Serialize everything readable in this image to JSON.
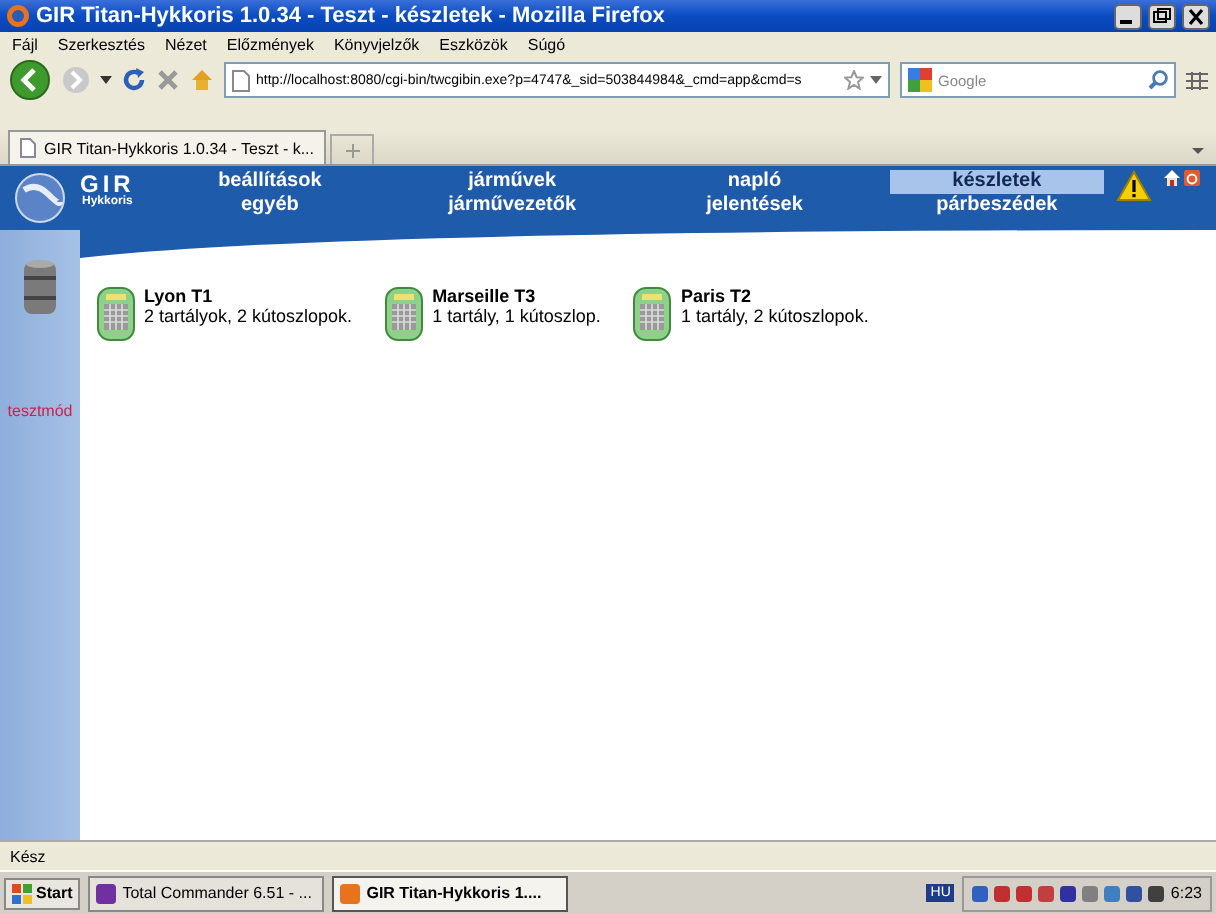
{
  "window": {
    "title": "GIR Titan-Hykkoris 1.0.34 - Teszt - készletek - Mozilla Firefox"
  },
  "menu": [
    "Fájl",
    "Szerkesztés",
    "Nézet",
    "Előzmények",
    "Könyvjelzők",
    "Eszközök",
    "Súgó"
  ],
  "address_bar": {
    "value": "http://localhost:8080/cgi-bin/twcgibin.exe?p=4747&_sid=503844984&_cmd=app&cmd=s"
  },
  "search": {
    "placeholder": "Google"
  },
  "browser_tabs": [
    {
      "label": "GIR Titan-Hykkoris 1.0.34 - Teszt - k...",
      "selected": true
    }
  ],
  "app": {
    "logo": {
      "title": "GIR",
      "subtitle": "Hykkoris"
    },
    "nav": [
      {
        "label": "beállítások",
        "selected": false
      },
      {
        "label": "járművek",
        "selected": false
      },
      {
        "label": "napló",
        "selected": false
      },
      {
        "label": "készletek",
        "selected": true
      },
      {
        "label": "egyéb",
        "selected": false
      },
      {
        "label": "járművezetők",
        "selected": false
      },
      {
        "label": "jelentések",
        "selected": false
      },
      {
        "label": "párbeszédek",
        "selected": false
      }
    ],
    "sidebar": {
      "mode_label": "tesztmód"
    },
    "stations": [
      {
        "name": "Lyon T1",
        "detail": "2 tartályok, 2 kútoszlopok."
      },
      {
        "name": "Marseille T3",
        "detail": "1 tartály, 1 kútoszlop."
      },
      {
        "name": "Paris T2",
        "detail": "1 tartály, 2 kútoszlopok."
      }
    ]
  },
  "status_bar": {
    "text": "Kész"
  },
  "taskbar": {
    "start": "Start",
    "tasks": [
      {
        "label": "Total Commander 6.51 - ...",
        "selected": false
      },
      {
        "label": "GIR Titan-Hykkoris 1....",
        "selected": true
      }
    ],
    "language": "HU",
    "clock": "6:23"
  }
}
